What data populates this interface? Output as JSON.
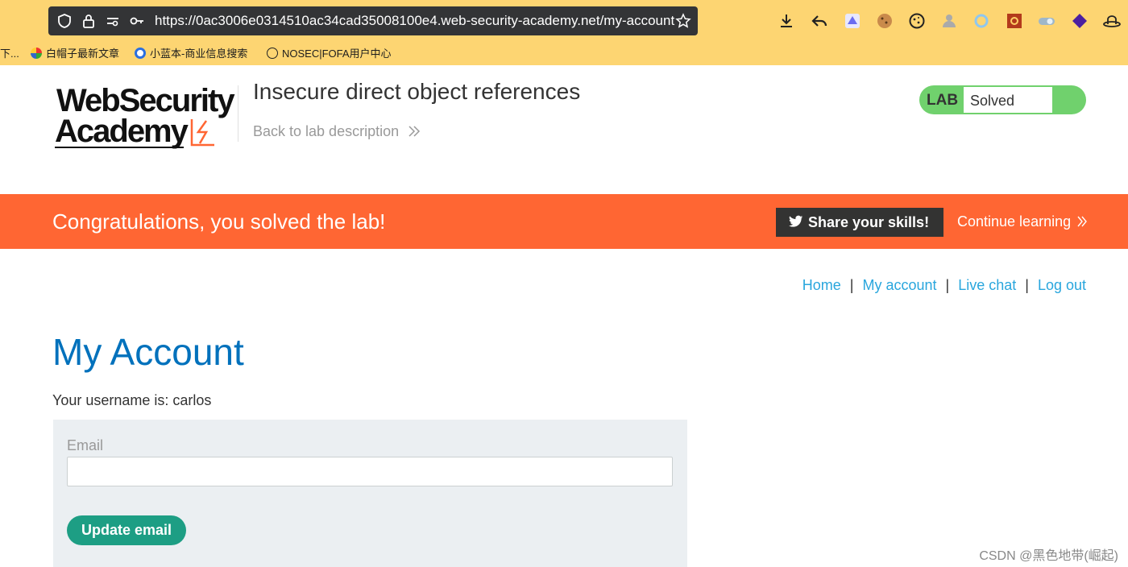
{
  "browser": {
    "url": "https://0ac3006e0314510ac34cad35008100e4.web-security-academy.net/my-account",
    "bookmarks": [
      {
        "label": "下...",
        "icon": "none"
      },
      {
        "label": "白帽子最新文章",
        "icon": "colorful-circle-icon"
      },
      {
        "label": "小蓝本-商业信息搜索",
        "icon": "blue-q-icon"
      },
      {
        "label": "NOSEC|FOFA用户中心",
        "icon": "globe-icon"
      }
    ],
    "colors": {
      "chrome": "#fdd572",
      "urlbar": "#333436"
    }
  },
  "header": {
    "logo_line1": "WebSecurity",
    "logo_line2": "Academy",
    "lab_title": "Insecure direct object references",
    "back_link": "Back to lab description",
    "badge_lab": "LAB",
    "badge_status": "Solved"
  },
  "banner": {
    "message": "Congratulations, you solved the lab!",
    "share_label": "Share your skills!",
    "continue_label": "Continue learning",
    "color": "#ff6633"
  },
  "nav": {
    "home": "Home",
    "account": "My account",
    "chat": "Live chat",
    "logout": "Log out",
    "separator": "|"
  },
  "main": {
    "title": "My Account",
    "username_text": "Your username is: carlos",
    "email_label": "Email",
    "email_value": "",
    "update_button": "Update email"
  },
  "watermark": "CSDN @黑色地带(崛起)"
}
